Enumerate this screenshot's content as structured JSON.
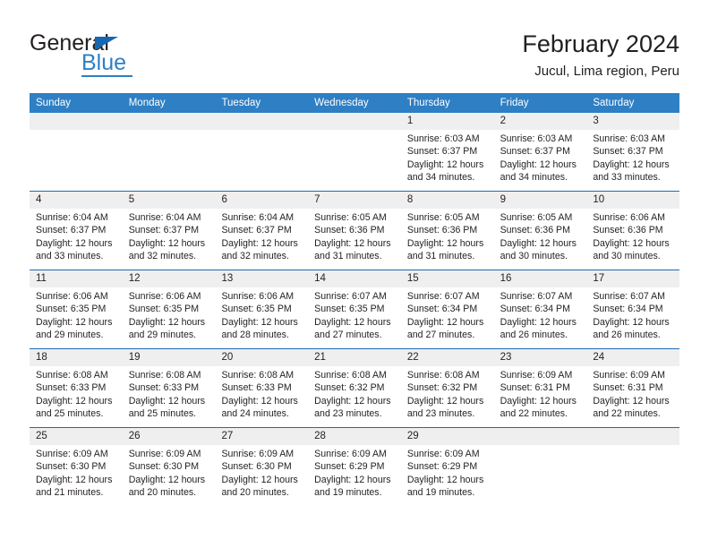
{
  "brand": {
    "name_top": "General",
    "name_bottom": "Blue",
    "triangle_icon": "triangle-icon",
    "accent_color": "#2e7fc4"
  },
  "header": {
    "title": "February 2024",
    "subtitle": "Jucul, Lima region, Peru"
  },
  "colors": {
    "header_bar": "#2e7fc4",
    "week_separator": "#1f6cae",
    "daynum_band": "#efefef",
    "text": "#231f20"
  },
  "weekdays": [
    "Sunday",
    "Monday",
    "Tuesday",
    "Wednesday",
    "Thursday",
    "Friday",
    "Saturday"
  ],
  "weeks": [
    {
      "days": [
        {
          "num": "",
          "lines": []
        },
        {
          "num": "",
          "lines": []
        },
        {
          "num": "",
          "lines": []
        },
        {
          "num": "",
          "lines": []
        },
        {
          "num": "1",
          "lines": [
            "Sunrise: 6:03 AM",
            "Sunset: 6:37 PM",
            "Daylight: 12 hours",
            "and 34 minutes."
          ]
        },
        {
          "num": "2",
          "lines": [
            "Sunrise: 6:03 AM",
            "Sunset: 6:37 PM",
            "Daylight: 12 hours",
            "and 34 minutes."
          ]
        },
        {
          "num": "3",
          "lines": [
            "Sunrise: 6:03 AM",
            "Sunset: 6:37 PM",
            "Daylight: 12 hours",
            "and 33 minutes."
          ]
        }
      ]
    },
    {
      "days": [
        {
          "num": "4",
          "lines": [
            "Sunrise: 6:04 AM",
            "Sunset: 6:37 PM",
            "Daylight: 12 hours",
            "and 33 minutes."
          ]
        },
        {
          "num": "5",
          "lines": [
            "Sunrise: 6:04 AM",
            "Sunset: 6:37 PM",
            "Daylight: 12 hours",
            "and 32 minutes."
          ]
        },
        {
          "num": "6",
          "lines": [
            "Sunrise: 6:04 AM",
            "Sunset: 6:37 PM",
            "Daylight: 12 hours",
            "and 32 minutes."
          ]
        },
        {
          "num": "7",
          "lines": [
            "Sunrise: 6:05 AM",
            "Sunset: 6:36 PM",
            "Daylight: 12 hours",
            "and 31 minutes."
          ]
        },
        {
          "num": "8",
          "lines": [
            "Sunrise: 6:05 AM",
            "Sunset: 6:36 PM",
            "Daylight: 12 hours",
            "and 31 minutes."
          ]
        },
        {
          "num": "9",
          "lines": [
            "Sunrise: 6:05 AM",
            "Sunset: 6:36 PM",
            "Daylight: 12 hours",
            "and 30 minutes."
          ]
        },
        {
          "num": "10",
          "lines": [
            "Sunrise: 6:06 AM",
            "Sunset: 6:36 PM",
            "Daylight: 12 hours",
            "and 30 minutes."
          ]
        }
      ]
    },
    {
      "days": [
        {
          "num": "11",
          "lines": [
            "Sunrise: 6:06 AM",
            "Sunset: 6:35 PM",
            "Daylight: 12 hours",
            "and 29 minutes."
          ]
        },
        {
          "num": "12",
          "lines": [
            "Sunrise: 6:06 AM",
            "Sunset: 6:35 PM",
            "Daylight: 12 hours",
            "and 29 minutes."
          ]
        },
        {
          "num": "13",
          "lines": [
            "Sunrise: 6:06 AM",
            "Sunset: 6:35 PM",
            "Daylight: 12 hours",
            "and 28 minutes."
          ]
        },
        {
          "num": "14",
          "lines": [
            "Sunrise: 6:07 AM",
            "Sunset: 6:35 PM",
            "Daylight: 12 hours",
            "and 27 minutes."
          ]
        },
        {
          "num": "15",
          "lines": [
            "Sunrise: 6:07 AM",
            "Sunset: 6:34 PM",
            "Daylight: 12 hours",
            "and 27 minutes."
          ]
        },
        {
          "num": "16",
          "lines": [
            "Sunrise: 6:07 AM",
            "Sunset: 6:34 PM",
            "Daylight: 12 hours",
            "and 26 minutes."
          ]
        },
        {
          "num": "17",
          "lines": [
            "Sunrise: 6:07 AM",
            "Sunset: 6:34 PM",
            "Daylight: 12 hours",
            "and 26 minutes."
          ]
        }
      ]
    },
    {
      "days": [
        {
          "num": "18",
          "lines": [
            "Sunrise: 6:08 AM",
            "Sunset: 6:33 PM",
            "Daylight: 12 hours",
            "and 25 minutes."
          ]
        },
        {
          "num": "19",
          "lines": [
            "Sunrise: 6:08 AM",
            "Sunset: 6:33 PM",
            "Daylight: 12 hours",
            "and 25 minutes."
          ]
        },
        {
          "num": "20",
          "lines": [
            "Sunrise: 6:08 AM",
            "Sunset: 6:33 PM",
            "Daylight: 12 hours",
            "and 24 minutes."
          ]
        },
        {
          "num": "21",
          "lines": [
            "Sunrise: 6:08 AM",
            "Sunset: 6:32 PM",
            "Daylight: 12 hours",
            "and 23 minutes."
          ]
        },
        {
          "num": "22",
          "lines": [
            "Sunrise: 6:08 AM",
            "Sunset: 6:32 PM",
            "Daylight: 12 hours",
            "and 23 minutes."
          ]
        },
        {
          "num": "23",
          "lines": [
            "Sunrise: 6:09 AM",
            "Sunset: 6:31 PM",
            "Daylight: 12 hours",
            "and 22 minutes."
          ]
        },
        {
          "num": "24",
          "lines": [
            "Sunrise: 6:09 AM",
            "Sunset: 6:31 PM",
            "Daylight: 12 hours",
            "and 22 minutes."
          ]
        }
      ]
    },
    {
      "days": [
        {
          "num": "25",
          "lines": [
            "Sunrise: 6:09 AM",
            "Sunset: 6:30 PM",
            "Daylight: 12 hours",
            "and 21 minutes."
          ]
        },
        {
          "num": "26",
          "lines": [
            "Sunrise: 6:09 AM",
            "Sunset: 6:30 PM",
            "Daylight: 12 hours",
            "and 20 minutes."
          ]
        },
        {
          "num": "27",
          "lines": [
            "Sunrise: 6:09 AM",
            "Sunset: 6:30 PM",
            "Daylight: 12 hours",
            "and 20 minutes."
          ]
        },
        {
          "num": "28",
          "lines": [
            "Sunrise: 6:09 AM",
            "Sunset: 6:29 PM",
            "Daylight: 12 hours",
            "and 19 minutes."
          ]
        },
        {
          "num": "29",
          "lines": [
            "Sunrise: 6:09 AM",
            "Sunset: 6:29 PM",
            "Daylight: 12 hours",
            "and 19 minutes."
          ]
        },
        {
          "num": "",
          "lines": []
        },
        {
          "num": "",
          "lines": []
        }
      ]
    }
  ]
}
